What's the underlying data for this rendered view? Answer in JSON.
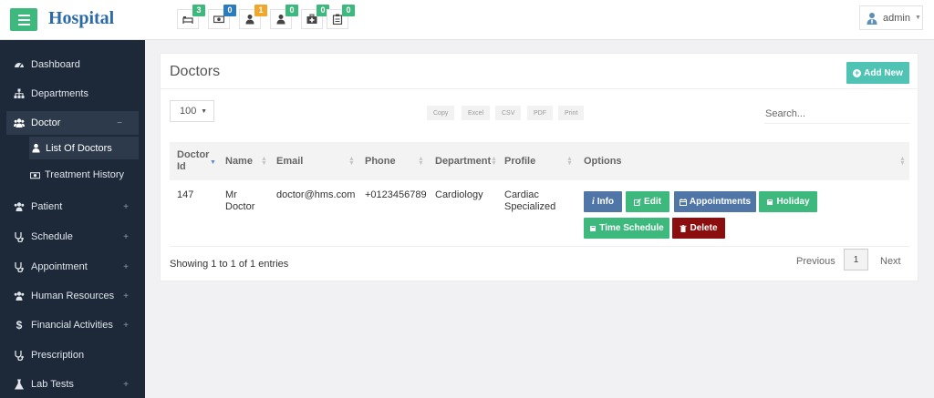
{
  "header": {
    "brand": "Hospital",
    "user_name": "admin",
    "notifications": [
      {
        "icon": "bed-icon",
        "count": "3",
        "color": "#3eb97d"
      },
      {
        "icon": "money-icon",
        "count": "0",
        "color": "#2a7bbf"
      },
      {
        "icon": "user-icon",
        "count": "1",
        "color": "#f0a72b"
      },
      {
        "icon": "user-icon",
        "count": "0",
        "color": "#3eb97d"
      },
      {
        "icon": "medkit-icon",
        "count": "0",
        "color": "#3eb97d"
      },
      {
        "icon": "clipboard-icon",
        "count": "0",
        "color": "#3eb97d"
      }
    ]
  },
  "sidebar": {
    "items": [
      {
        "label": "Dashboard",
        "icon": "dashboard-icon"
      },
      {
        "label": "Departments",
        "icon": "sitemap-icon"
      },
      {
        "label": "Doctor",
        "icon": "users-icon",
        "expanded": true
      },
      {
        "label": "Patient",
        "icon": "users-icon"
      },
      {
        "label": "Schedule",
        "icon": "stethoscope-icon"
      },
      {
        "label": "Appointment",
        "icon": "stethoscope-icon"
      },
      {
        "label": "Human Resources",
        "icon": "users-icon"
      },
      {
        "label": "Financial Activities",
        "icon": "dollar-icon"
      },
      {
        "label": "Prescription",
        "icon": "stethoscope-icon"
      },
      {
        "label": "Lab Tests",
        "icon": "flask-icon"
      }
    ],
    "doctor_subitems": [
      {
        "label": "List Of Doctors",
        "icon": "user-icon"
      },
      {
        "label": "Treatment History",
        "icon": "money-icon"
      }
    ],
    "expand_symbol": "+",
    "collapse_symbol": "−"
  },
  "panel": {
    "title": "Doctors",
    "add_button": "Add New",
    "page_length": "100",
    "export_buttons": [
      "Copy",
      "Excel",
      "CSV",
      "PDF",
      "Print"
    ],
    "search_placeholder": "Search...",
    "columns": [
      "Doctor Id",
      "Name",
      "Email",
      "Phone",
      "Department",
      "Profile",
      "Options"
    ],
    "rows": [
      {
        "id": "147",
        "name": "Mr Doctor",
        "email": "doctor@hms.com",
        "phone": "+0123456789",
        "department": "Cardiology",
        "profile": "Cardiac Specialized"
      }
    ],
    "row_actions": {
      "info": "Info",
      "edit": "Edit",
      "appointments": "Appointments",
      "holiday": "Holiday",
      "time_schedule": "Time Schedule",
      "delete": "Delete"
    },
    "footer": {
      "showing": "Showing 1 to 1 of 1 entries",
      "previous": "Previous",
      "page": "1",
      "next": "Next"
    }
  },
  "colors": {
    "sidebar_bg": "#1d2939",
    "accent_green": "#3eb97d",
    "info": "#4f76a6",
    "edit": "#3eb97d",
    "appointments": "#4f76a6",
    "holiday": "#3eb97d",
    "time_schedule": "#3eb97d",
    "delete": "#8b0d0d",
    "add_new": "#4fc3b4"
  }
}
